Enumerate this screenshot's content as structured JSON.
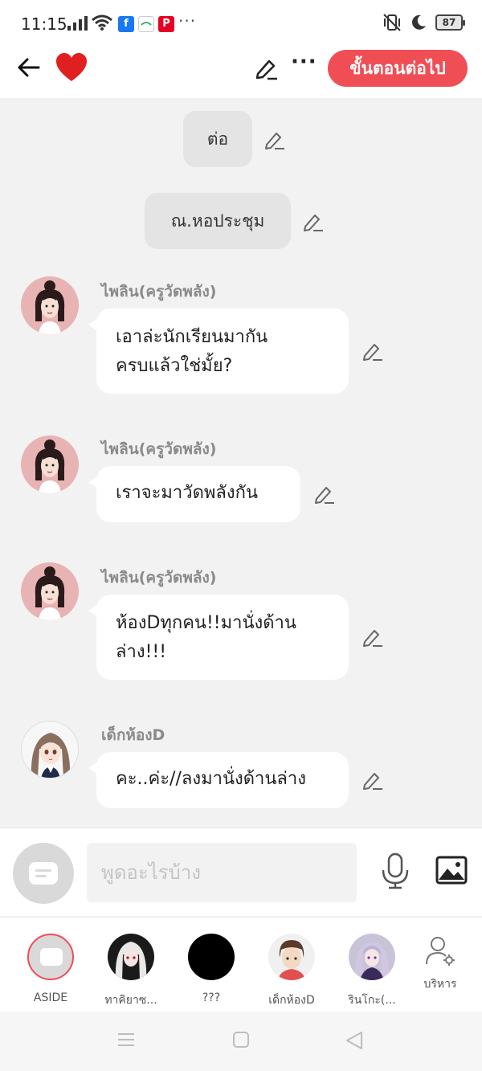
{
  "status": {
    "time": "11:15",
    "more": "···",
    "battery": "87"
  },
  "header": {
    "next_label": "ขั้นตอนต่อไป"
  },
  "chat": {
    "narrations": [
      "ต่อ",
      "ณ.หอประชุม"
    ],
    "messages": [
      {
        "sender": "ไพลิน(ครูวัดพลัง)",
        "lines": [
          "เอาล่ะนักเรียนมากัน",
          "ครบแล้วใช่มั้ย?"
        ]
      },
      {
        "sender": "ไพลิน(ครูวัดพลัง)",
        "lines": [
          "เราจะมาวัดพลังกัน"
        ]
      },
      {
        "sender": "ไพลิน(ครูวัดพลัง)",
        "lines": [
          "ห้องDทุกคน!!มานั่งด้าน",
          "ล่าง!!!"
        ]
      },
      {
        "sender": "เด็กห้องD",
        "lines": [
          "คะ..ค่ะ//ลงมานั่งด้านล่าง"
        ]
      }
    ]
  },
  "input": {
    "placeholder": "พูดอะไรบ้าง"
  },
  "characters": [
    {
      "name": "ASIDE"
    },
    {
      "name": "ทาคิยาซ..."
    },
    {
      "name": "???"
    },
    {
      "name": "เด็กห้องD"
    },
    {
      "name": "รินโกะ(..."
    }
  ],
  "admin_label": "บริหาร",
  "colors": {
    "accent": "#f04e55",
    "heart": "#e02020",
    "background": "#f2f2f2"
  }
}
